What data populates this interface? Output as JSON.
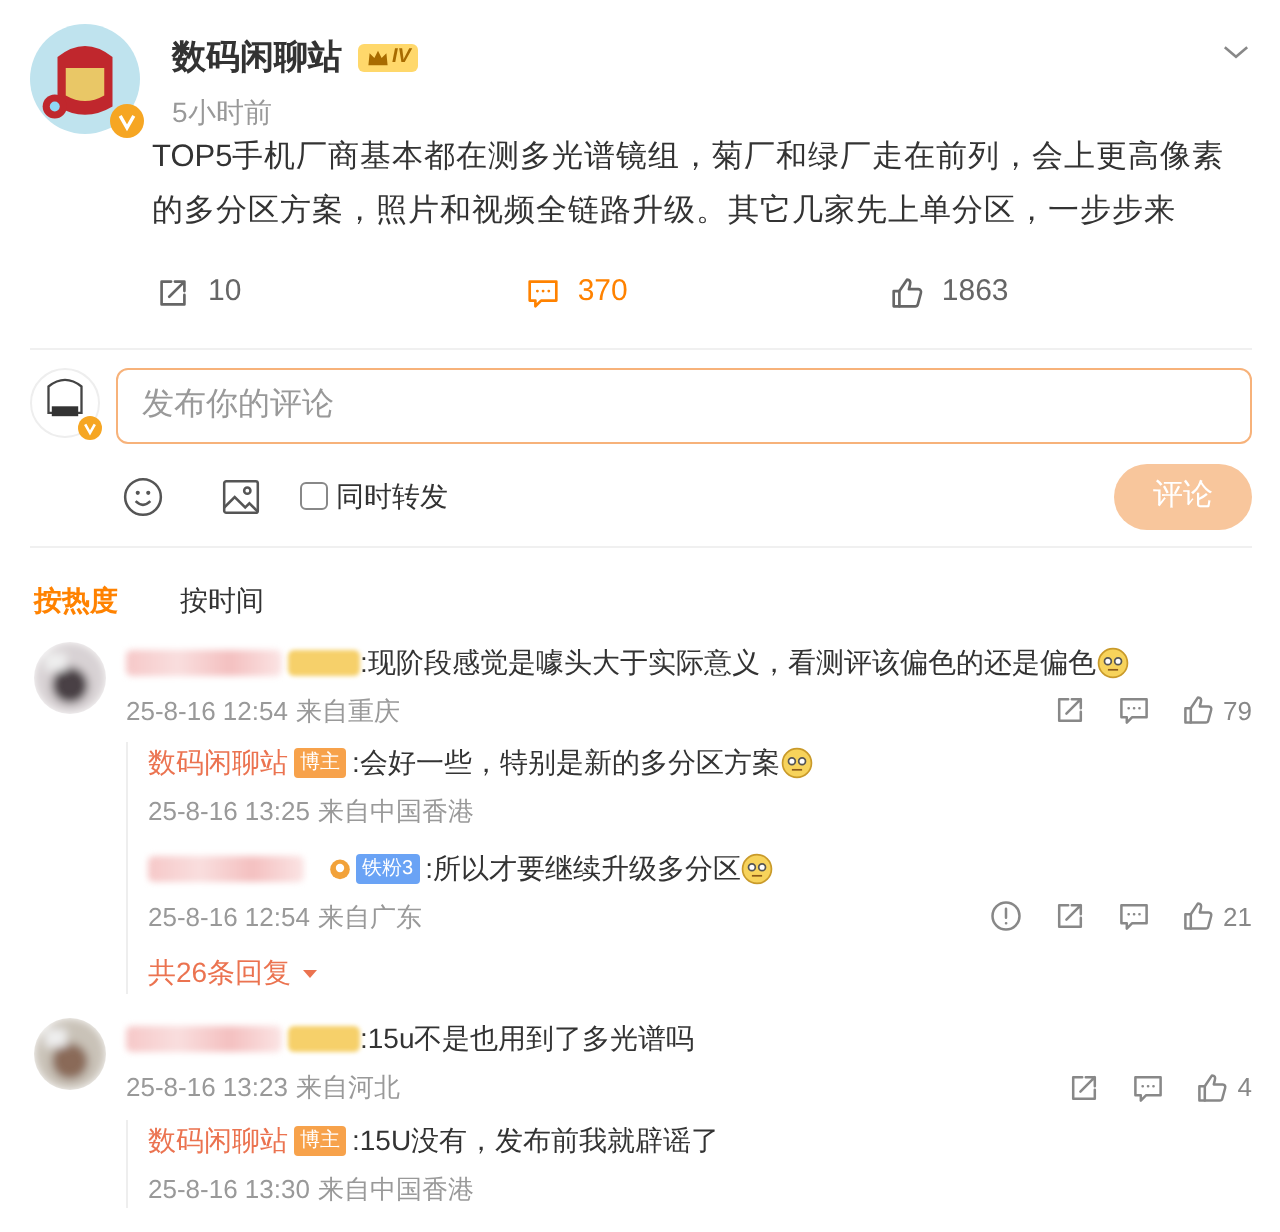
{
  "post": {
    "author": "数码闲聊站",
    "level_badge": "IV",
    "verified": true,
    "time": "5小时前",
    "text": "TOP5手机厂商基本都在测多光谱镜组，菊厂和绿厂走在前列，会上更高像素的多分区方案，照片和视频全链路升级。其它几家先上单分区，一步步来",
    "actions": [
      {
        "kind": "share",
        "count": "10",
        "selected": false
      },
      {
        "kind": "comment",
        "count": "370",
        "selected": true
      },
      {
        "kind": "like",
        "count": "1863",
        "selected": false
      }
    ]
  },
  "composer": {
    "placeholder": "发布你的评论",
    "repost": {
      "label": "同时转发",
      "checked": false
    },
    "submit": {
      "label": "评论",
      "disabled": true
    }
  },
  "sort_tabs": [
    {
      "label": "按热度",
      "selected": true
    },
    {
      "label": "按时间",
      "selected": false
    }
  ],
  "comments": [
    {
      "user": {
        "kind": "blurred"
      },
      "badge": {
        "kind": "blurred"
      },
      "text": ":现阶段感觉是噱头大于实际意义，看测评该偏色的还是偏色",
      "emoji": true,
      "date": "25-8-16 12:54",
      "location": "来自重庆",
      "report": false,
      "likes": "79",
      "replies": [
        {
          "user": {
            "kind": "named",
            "name": "数码闲聊站"
          },
          "badge": {
            "kind": "host",
            "label": "博主"
          },
          "text": ":会好一些，特别是新的多分区方案",
          "emoji": true,
          "date": "25-8-16 13:25",
          "location": "来自中国香港"
        },
        {
          "user": {
            "kind": "blurred"
          },
          "badge": {
            "kind": "fan",
            "label": "铁粉3"
          },
          "text": ":所以才要继续升级多分区",
          "emoji": true,
          "date": "25-8-16 12:54",
          "location": "来自广东",
          "report": true,
          "likes": "21"
        }
      ],
      "more_replies": "共26条回复"
    },
    {
      "user": {
        "kind": "blurred"
      },
      "badge": {
        "kind": "blurred"
      },
      "text": ":15u不是也用到了多光谱吗",
      "emoji": false,
      "date": "25-8-16 13:23",
      "location": "来自河北",
      "report": false,
      "likes": "4",
      "replies": [
        {
          "user": {
            "kind": "named",
            "name": "数码闲聊站"
          },
          "badge": {
            "kind": "host",
            "label": "博主"
          },
          "text": ":15U没有，发布前我就辟谣了",
          "emoji": false,
          "date": "25-8-16 13:30",
          "location": "来自中国香港"
        }
      ]
    }
  ]
}
